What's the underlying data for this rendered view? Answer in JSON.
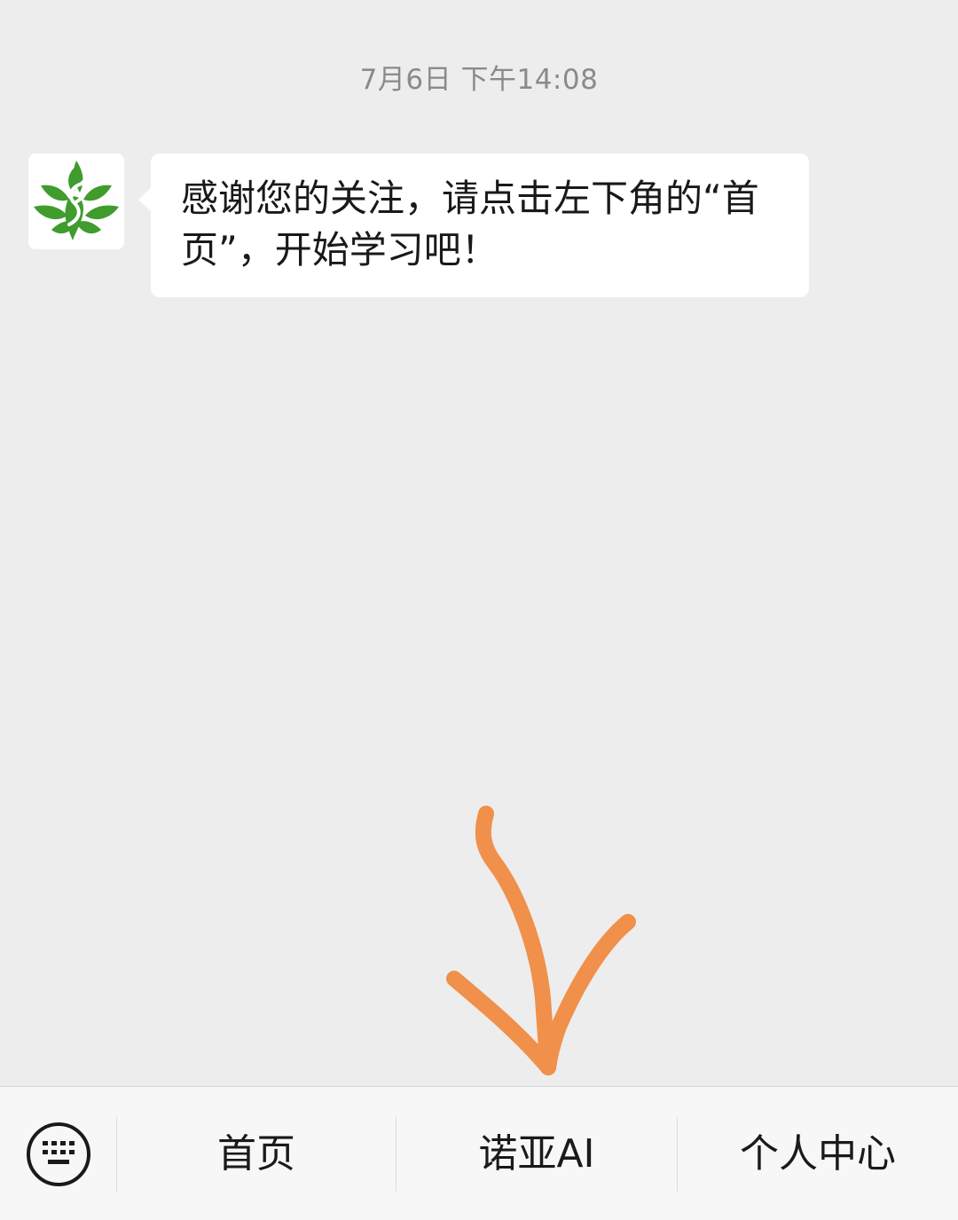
{
  "chat": {
    "timestamp": "7月6日 下午14:08",
    "messages": [
      {
        "sender_avatar": "leaf-logo-icon",
        "text": "感谢您的关注，请点击左下角的“首页”，开始学习吧！"
      }
    ]
  },
  "annotation": {
    "arrow_color": "#f0904a",
    "icon": "hand-drawn-arrow-icon"
  },
  "menu": {
    "keyboard_icon": "keyboard-icon",
    "items": [
      {
        "label": "首页"
      },
      {
        "label": "诺亚AI"
      },
      {
        "label": "个人中心"
      }
    ]
  },
  "colors": {
    "background": "#ededed",
    "bubble": "#ffffff",
    "logo_green": "#3a9a2a",
    "menu_bg": "#f7f7f7"
  }
}
